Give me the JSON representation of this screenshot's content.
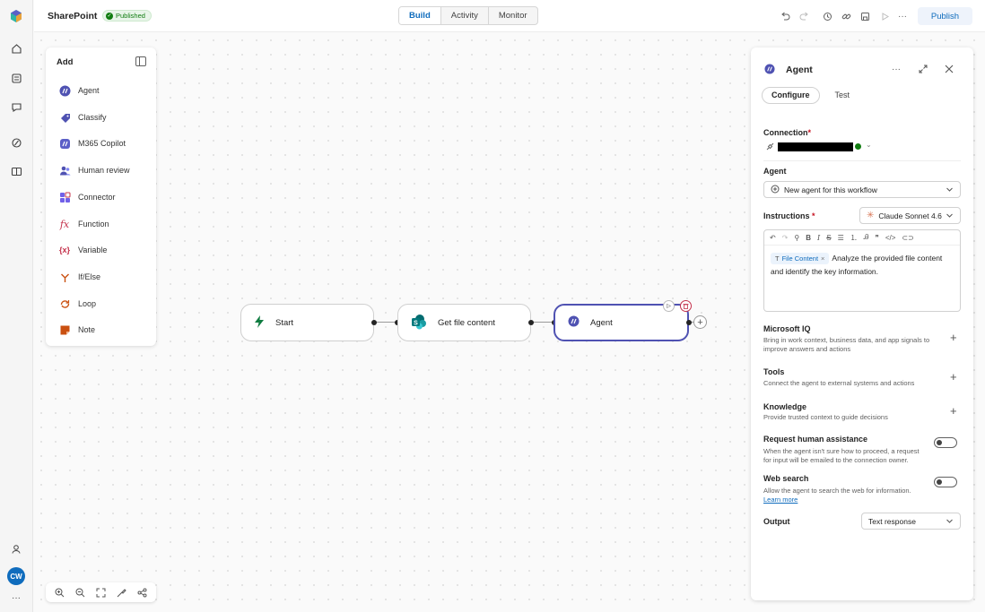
{
  "app": {
    "title": "SharePoint",
    "status_badge": "Published"
  },
  "rail": {
    "avatar_initials": "CW",
    "icons": [
      "copilot-studio-logo-icon",
      "home-icon",
      "catalog-icon",
      "chat-icon",
      "flows-icon",
      "library-icon",
      "account-icon",
      "more-icon"
    ]
  },
  "tabs": [
    {
      "label": "Build",
      "active": true
    },
    {
      "label": "Activity",
      "active": false
    },
    {
      "label": "Monitor",
      "active": false
    }
  ],
  "toolbar": {
    "icons": [
      "undo-icon",
      "redo-icon",
      "history-icon",
      "link-icon",
      "save-icon",
      "run-icon",
      "more-icon"
    ],
    "publish_label": "Publish"
  },
  "add_panel": {
    "title": "Add",
    "items": [
      {
        "label": "Agent",
        "icon": "agent-icon",
        "color": "#4f52b2"
      },
      {
        "label": "Classify",
        "icon": "classify-icon",
        "color": "#4f52b2"
      },
      {
        "label": "M365 Copilot",
        "icon": "copilot-icon",
        "color": "#4f52b2"
      },
      {
        "label": "Human review",
        "icon": "people-icon",
        "color": "#4f52b2"
      },
      {
        "label": "Connector",
        "icon": "connector-icon",
        "color": "#7160e8"
      },
      {
        "label": "Function",
        "icon": "function-icon",
        "color": "#c4314b"
      },
      {
        "label": "Variable",
        "icon": "variable-icon",
        "color": "#c4314b"
      },
      {
        "label": "If/Else",
        "icon": "branch-icon",
        "color": "#ca5010"
      },
      {
        "label": "Loop",
        "icon": "loop-icon",
        "color": "#ca5010"
      },
      {
        "label": "Note",
        "icon": "note-icon",
        "color": "#ca5010"
      }
    ]
  },
  "flow": {
    "nodes": [
      {
        "label": "Start",
        "icon": "lightning-icon"
      },
      {
        "label": "Get file content",
        "icon": "sharepoint-icon"
      },
      {
        "label": "Agent",
        "icon": "agent-icon",
        "selected": true
      }
    ]
  },
  "zoom_controls": [
    "zoom-in-icon",
    "zoom-out-icon",
    "fit-view-icon",
    "tidy-icon",
    "share-icon"
  ],
  "config": {
    "title": "Agent",
    "tabs": [
      {
        "label": "Configure",
        "active": true
      },
      {
        "label": "Test",
        "active": false
      }
    ],
    "connection": {
      "label": "Connection",
      "required_mark": "*"
    },
    "agent": {
      "label": "Agent",
      "value": "New agent for this workflow"
    },
    "instructions": {
      "label": "Instructions",
      "required_mark": "*",
      "model": "Claude Sonnet 4.6",
      "chip": "File Content",
      "text": "Analyze the provided file content and identify the key information."
    },
    "microsoft_iq": {
      "title": "Microsoft IQ",
      "desc": "Bring in work context, business data, and app signals to improve answers and actions"
    },
    "tools": {
      "title": "Tools",
      "desc": "Connect the agent to external systems and actions"
    },
    "knowledge": {
      "title": "Knowledge",
      "desc": "Provide trusted context to guide decisions"
    },
    "human_assistance": {
      "title": "Request human assistance",
      "desc": "When the agent isn't sure how to proceed, a request for input will be emailed to the connection owner.",
      "enabled": false
    },
    "web_search": {
      "title": "Web search",
      "desc": "Allow the agent to search the web for information.",
      "link": "Learn more",
      "enabled": false
    },
    "output": {
      "label": "Output",
      "value": "Text response"
    }
  },
  "colors": {
    "accent": "#0f6cbd",
    "agent_purple": "#4f52b2",
    "published_green": "#107c10"
  }
}
